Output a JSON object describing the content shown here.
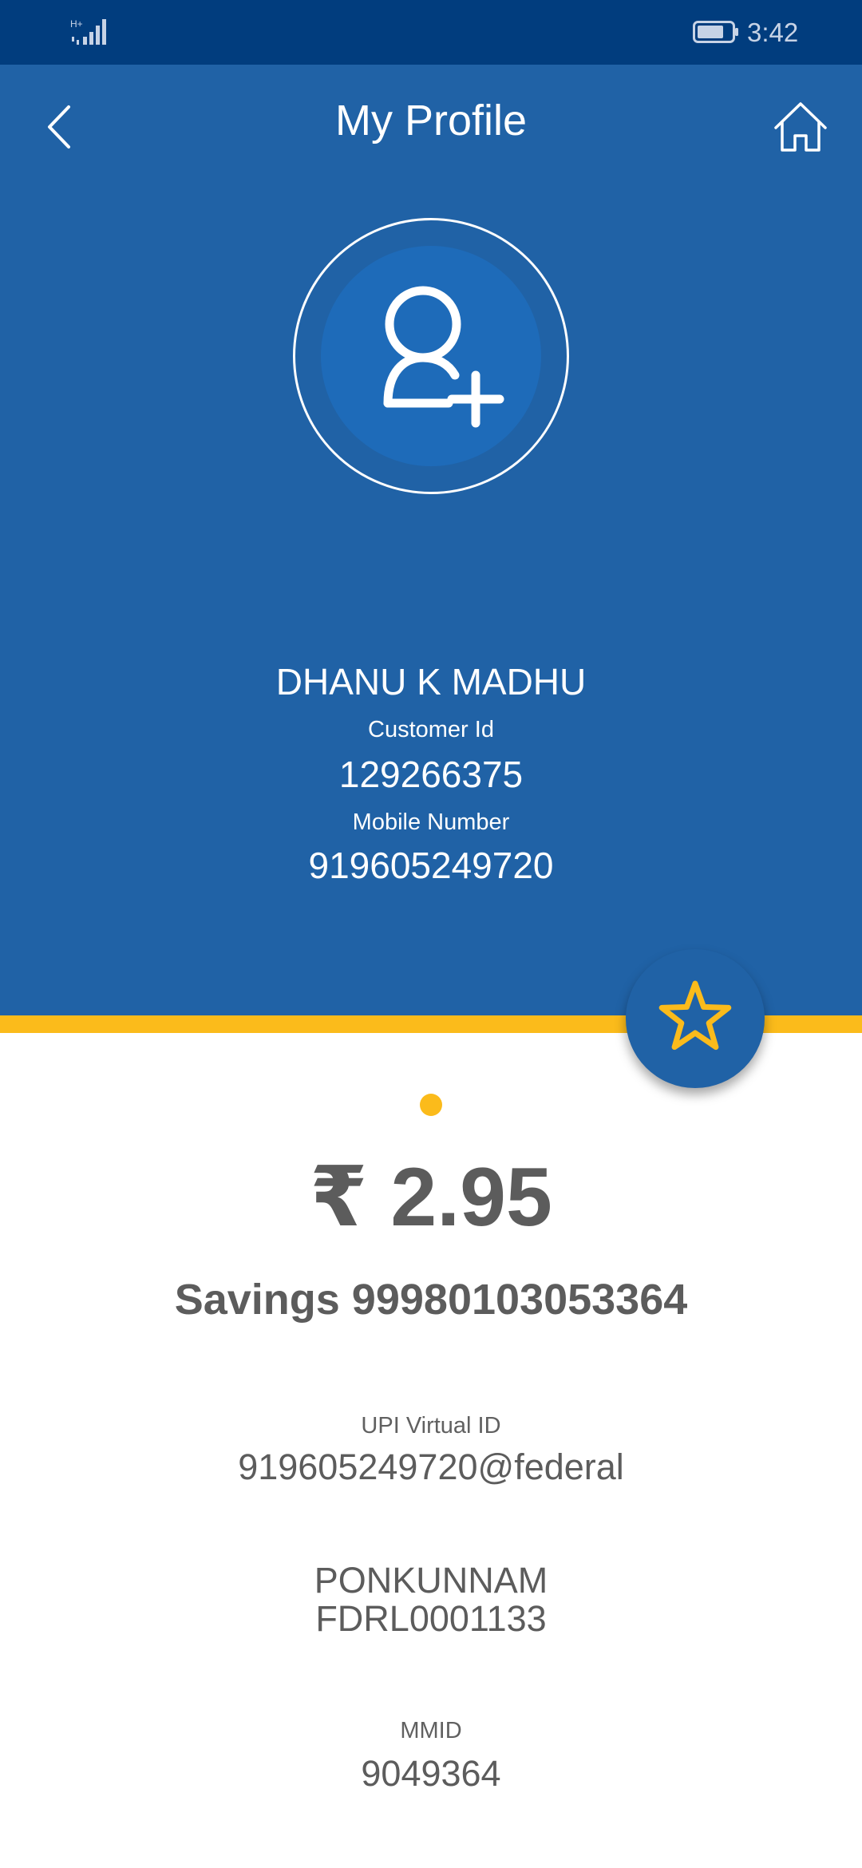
{
  "status_bar": {
    "network": "H+",
    "time": "3:42",
    "icons": [
      "signal-icon",
      "battery-icon"
    ]
  },
  "header": {
    "title": "My Profile",
    "back_icon": "chevron-left-icon",
    "home_icon": "home-icon"
  },
  "avatar": {
    "icon": "add-user-icon"
  },
  "profile": {
    "name": "DHANU K MADHU",
    "customer_id_label": "Customer Id",
    "customer_id": "129266375",
    "mobile_label": "Mobile Number",
    "mobile": "919605249720"
  },
  "favorite": {
    "icon": "star-icon"
  },
  "account": {
    "balance": "₹ 2.95",
    "account_line": "Savings 99980103053364",
    "upi_label": "UPI Virtual ID",
    "upi_id": "919605249720@federal",
    "branch": "PONKUNNAM",
    "ifsc": "FDRL0001133",
    "mmid_label": "MMID",
    "mmid": "9049364"
  },
  "colors": {
    "header_bg": "#2062a6",
    "status_bg": "#013d7e",
    "accent": "#fbbb1b",
    "text_dark": "#5c5c5c"
  }
}
